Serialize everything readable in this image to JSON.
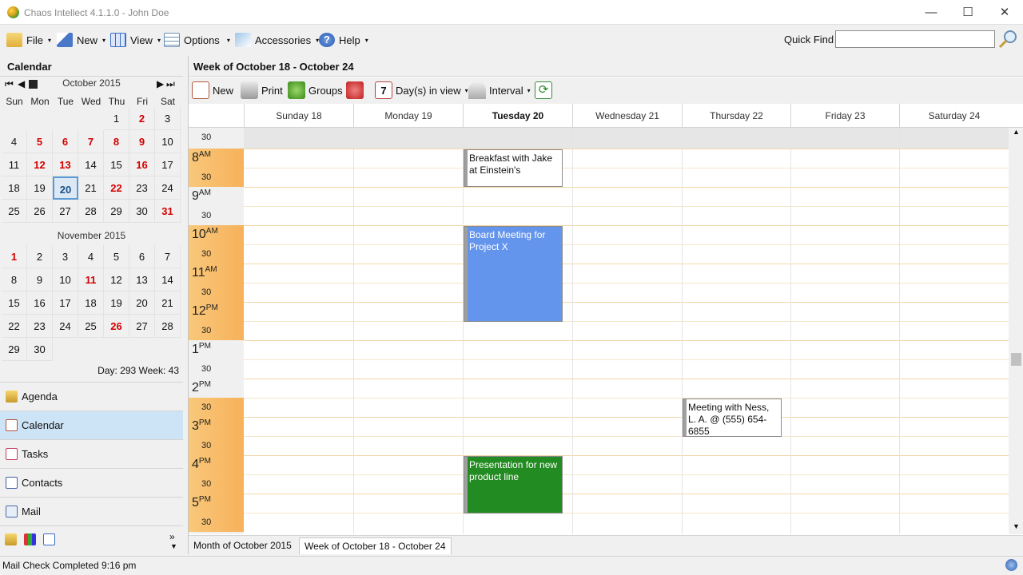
{
  "window": {
    "title": "Chaos Intellect 4.1.1.0 - John Doe",
    "minimize": "—",
    "maximize": "☐",
    "close": "✕"
  },
  "menu": {
    "file": "File",
    "new": "New",
    "view": "View",
    "options": "Options",
    "accessories": "Accessories",
    "help": "Help"
  },
  "quickfind": {
    "label": "Quick Find",
    "value": ""
  },
  "left": {
    "header": "Calendar",
    "oct": {
      "title": "October 2015"
    },
    "nov": {
      "title": "November 2015"
    },
    "dow": [
      "Sun",
      "Mon",
      "Tue",
      "Wed",
      "Thu",
      "Fri",
      "Sat"
    ],
    "daystat": "Day: 293  Week: 43",
    "nav": {
      "agenda": "Agenda",
      "calendar": "Calendar",
      "tasks": "Tasks",
      "contacts": "Contacts",
      "mail": "Mail"
    }
  },
  "main": {
    "week_title": "Week of October 18 - October 24",
    "toolbar": {
      "new": "New",
      "print": "Print",
      "groups": "Groups",
      "days": "Day(s) in view",
      "interval": "Interval"
    },
    "days": [
      "Sunday 18",
      "Monday 19",
      "Tuesday 20",
      "Wednesday 21",
      "Thursday 22",
      "Friday 23",
      "Saturday 24"
    ],
    "appointments": [
      {
        "text": "Breakfast with Jake at Einstein's",
        "color": "#ffffff"
      },
      {
        "text": "Board Meeting for Project X",
        "color": "#6495ed"
      },
      {
        "text": "Meeting with Ness, L. A. @ (555) 654-6855",
        "color": "#ffffff"
      },
      {
        "text": "Presentation for new product line",
        "color": "#228b22"
      }
    ],
    "hours": [
      {
        "h": "8",
        "ampm": "AM"
      },
      {
        "h": "9",
        "ampm": "AM"
      },
      {
        "h": "10",
        "ampm": "AM"
      },
      {
        "h": "11",
        "ampm": "AM"
      },
      {
        "h": "12",
        "ampm": "PM"
      },
      {
        "h": "1",
        "ampm": "PM"
      },
      {
        "h": "2",
        "ampm": "PM"
      },
      {
        "h": "3",
        "ampm": "PM"
      },
      {
        "h": "4",
        "ampm": "PM"
      },
      {
        "h": "5",
        "ampm": "PM"
      }
    ],
    "half": "30",
    "tabs": {
      "month": "Month of October 2015",
      "week": "Week of October 18 - October 24"
    }
  },
  "status": {
    "text": "Mail Check Completed 9:16 pm"
  },
  "colors": {
    "accent": "#5b9bd5",
    "work_hours": "#f7b15b",
    "today_bg": "#dde8f5",
    "red_date": "#d40000"
  }
}
